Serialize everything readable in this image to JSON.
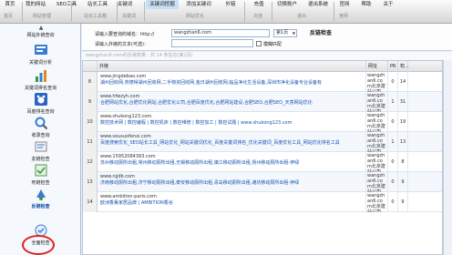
{
  "toolbar": {
    "tabs": [
      {
        "label": "首页",
        "active": false
      },
      {
        "label": "我的网站",
        "active": false
      },
      {
        "label": "SEO工具",
        "active": false
      },
      {
        "label": "站长工具",
        "active": false
      },
      {
        "label": "关键词",
        "active": false
      },
      {
        "label": "关键词挖掘",
        "active": true
      },
      {
        "label": "添加关键词",
        "active": false
      },
      {
        "label": "外链",
        "active": false
      },
      {
        "label": "充值",
        "active": false
      },
      {
        "label": "切换账户",
        "active": false
      },
      {
        "label": "退出系统",
        "active": false
      },
      {
        "label": "官网",
        "active": false
      },
      {
        "label": "帮助",
        "active": false
      },
      {
        "label": "关于",
        "active": false
      }
    ],
    "groups": [
      "首页",
      "网站管理",
      "站长工具箱",
      "关键词",
      "网站优化",
      "充值",
      "退出",
      "官网"
    ]
  },
  "sidebar": {
    "items": [
      {
        "label": "网站外链查询",
        "icon": "link-icon",
        "bold": false
      },
      {
        "label": "关键词分析",
        "icon": "keyword-icon",
        "bold": false
      },
      {
        "label": "关键词排名查询",
        "icon": "chart-icon",
        "bold": false
      },
      {
        "label": "百度排名查询",
        "icon": "baidu-icon",
        "bold": false
      },
      {
        "label": "收录查询",
        "icon": "index-icon",
        "bold": false
      },
      {
        "label": "友链检查",
        "icon": "friend-link-icon",
        "bold": false
      },
      {
        "label": "死链检查",
        "icon": "dead-link-icon",
        "bold": false
      },
      {
        "label": "反链检查",
        "icon": "backlink-icon",
        "bold": true
      },
      {
        "label": "全面检查",
        "icon": "full-check-icon",
        "bold": false
      }
    ]
  },
  "form": {
    "domain_label": "请输入要查询的域名：http://",
    "domain_value": "wangzhan6.com",
    "page_select": "第1页",
    "run_label": "反链检查",
    "anchor_label": "请输入外链的文本(可选)：",
    "anchor_value": "",
    "fuzzy_label": "模糊匹配"
  },
  "status": "wangzhan6.com的反链数量：共 14 条信息(第1页)",
  "table": {
    "headers": [
      "",
      "外链",
      "网址",
      "PR",
      "权...",
      ""
    ],
    "rows": [
      {
        "num": "8",
        "url": "www.jingdebao.com",
        "desc": "湖州回收网,劳德得湖州回收网,二手物资回收网,金日湖州回收网,临品净化生活设备,深圳市净化设备专业设备有",
        "site": "wangzhan6.com北京建站公司",
        "pr": "0",
        "rank": "14"
      },
      {
        "num": "9",
        "url": "www.hfwzyh.com",
        "desc": "合肥网站优化,合肥优化网站,合肥优化公司,合肥百度优化,合肥网站建设,合肥SEO,合肥SEO_天意网站优化",
        "site": "wangzhan6.com北京建站公司",
        "pr": "1",
        "rank": "31"
      },
      {
        "num": "10",
        "url": "www.shukong123.com",
        "desc": "数控技术网 | 数控编程 | 数控机床 | 数控维修 | 数控加工 | 数控试题 | www.shukong123.com",
        "site": "wangzhan6.com北京建站公司",
        "pr": "0",
        "rank": "19"
      },
      {
        "num": "11",
        "url": "www.sousuofenxi.com",
        "desc": "百度搜索优化_SEO站长工具_网站优化_网站关键词优化_百度关键词排名_优化关键词_百度优化工具_网站优化排名工具",
        "site": "wangzhan6.com北京建站公司",
        "pr": "1",
        "rank": "13"
      },
      {
        "num": "12",
        "url": "www.15952084393.com",
        "desc": "苏州移动厕所出租,常州移动厕所出租,无锡移动厕所出租,镇江移动厕所出租,扬州移动厕所出租-伊绿",
        "site": "wangzhan6.com北京建站公司",
        "pr": "0",
        "rank": "8"
      },
      {
        "num": "13",
        "url": "www.njjdb.com",
        "desc": "济南移动厕所出租,济宁移动厕所出租,泰安移动厕所出租,青岛移动厕所出租,潍坊移动厕所出租-伊绿",
        "site": "wangzhan6.com北京建站公司",
        "pr": "0",
        "rank": "9"
      },
      {
        "num": "14",
        "url": "www.ambition-paris.com",
        "desc": "欧洲香薰家居品牌 | AMBITION香谷",
        "site": "wangzhan6.com北京建站公司",
        "pr": "0",
        "rank": "9"
      }
    ]
  },
  "colors": {
    "accent": "#1652b5",
    "marker": "#e02020"
  }
}
